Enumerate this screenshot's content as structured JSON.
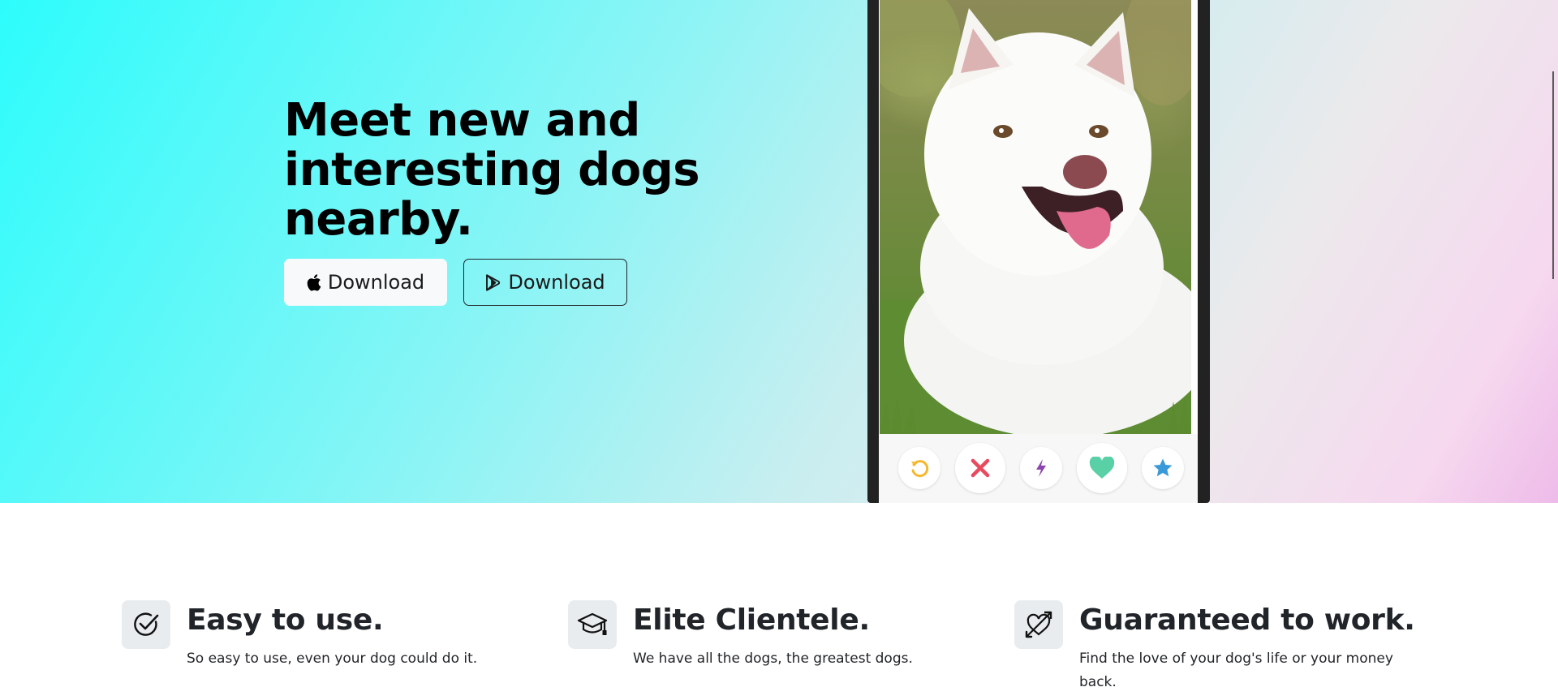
{
  "hero": {
    "title": "Meet new and interesting dogs nearby.",
    "apple_button_label": "Download",
    "play_button_label": "Download"
  },
  "phone": {
    "actions": [
      "rewind-icon",
      "dislike-icon",
      "boost-icon",
      "like-icon",
      "superlike-icon"
    ]
  },
  "features": [
    {
      "icon": "check-circle-icon",
      "title": "Easy to use.",
      "text": "So easy to use, even your dog could do it."
    },
    {
      "icon": "mortarboard-icon",
      "title": "Elite Clientele.",
      "text": "We have all the dogs, the greatest dogs."
    },
    {
      "icon": "heart-arrow-icon",
      "title": "Guaranteed to work.",
      "text": "Find the love of your dog's life or your money back."
    }
  ],
  "colors": {
    "rewind": "#f5b82e",
    "dislike": "#e84a5f",
    "boost": "#8e44ad",
    "like": "#5ad0a6",
    "superlike": "#3a9ad9"
  }
}
